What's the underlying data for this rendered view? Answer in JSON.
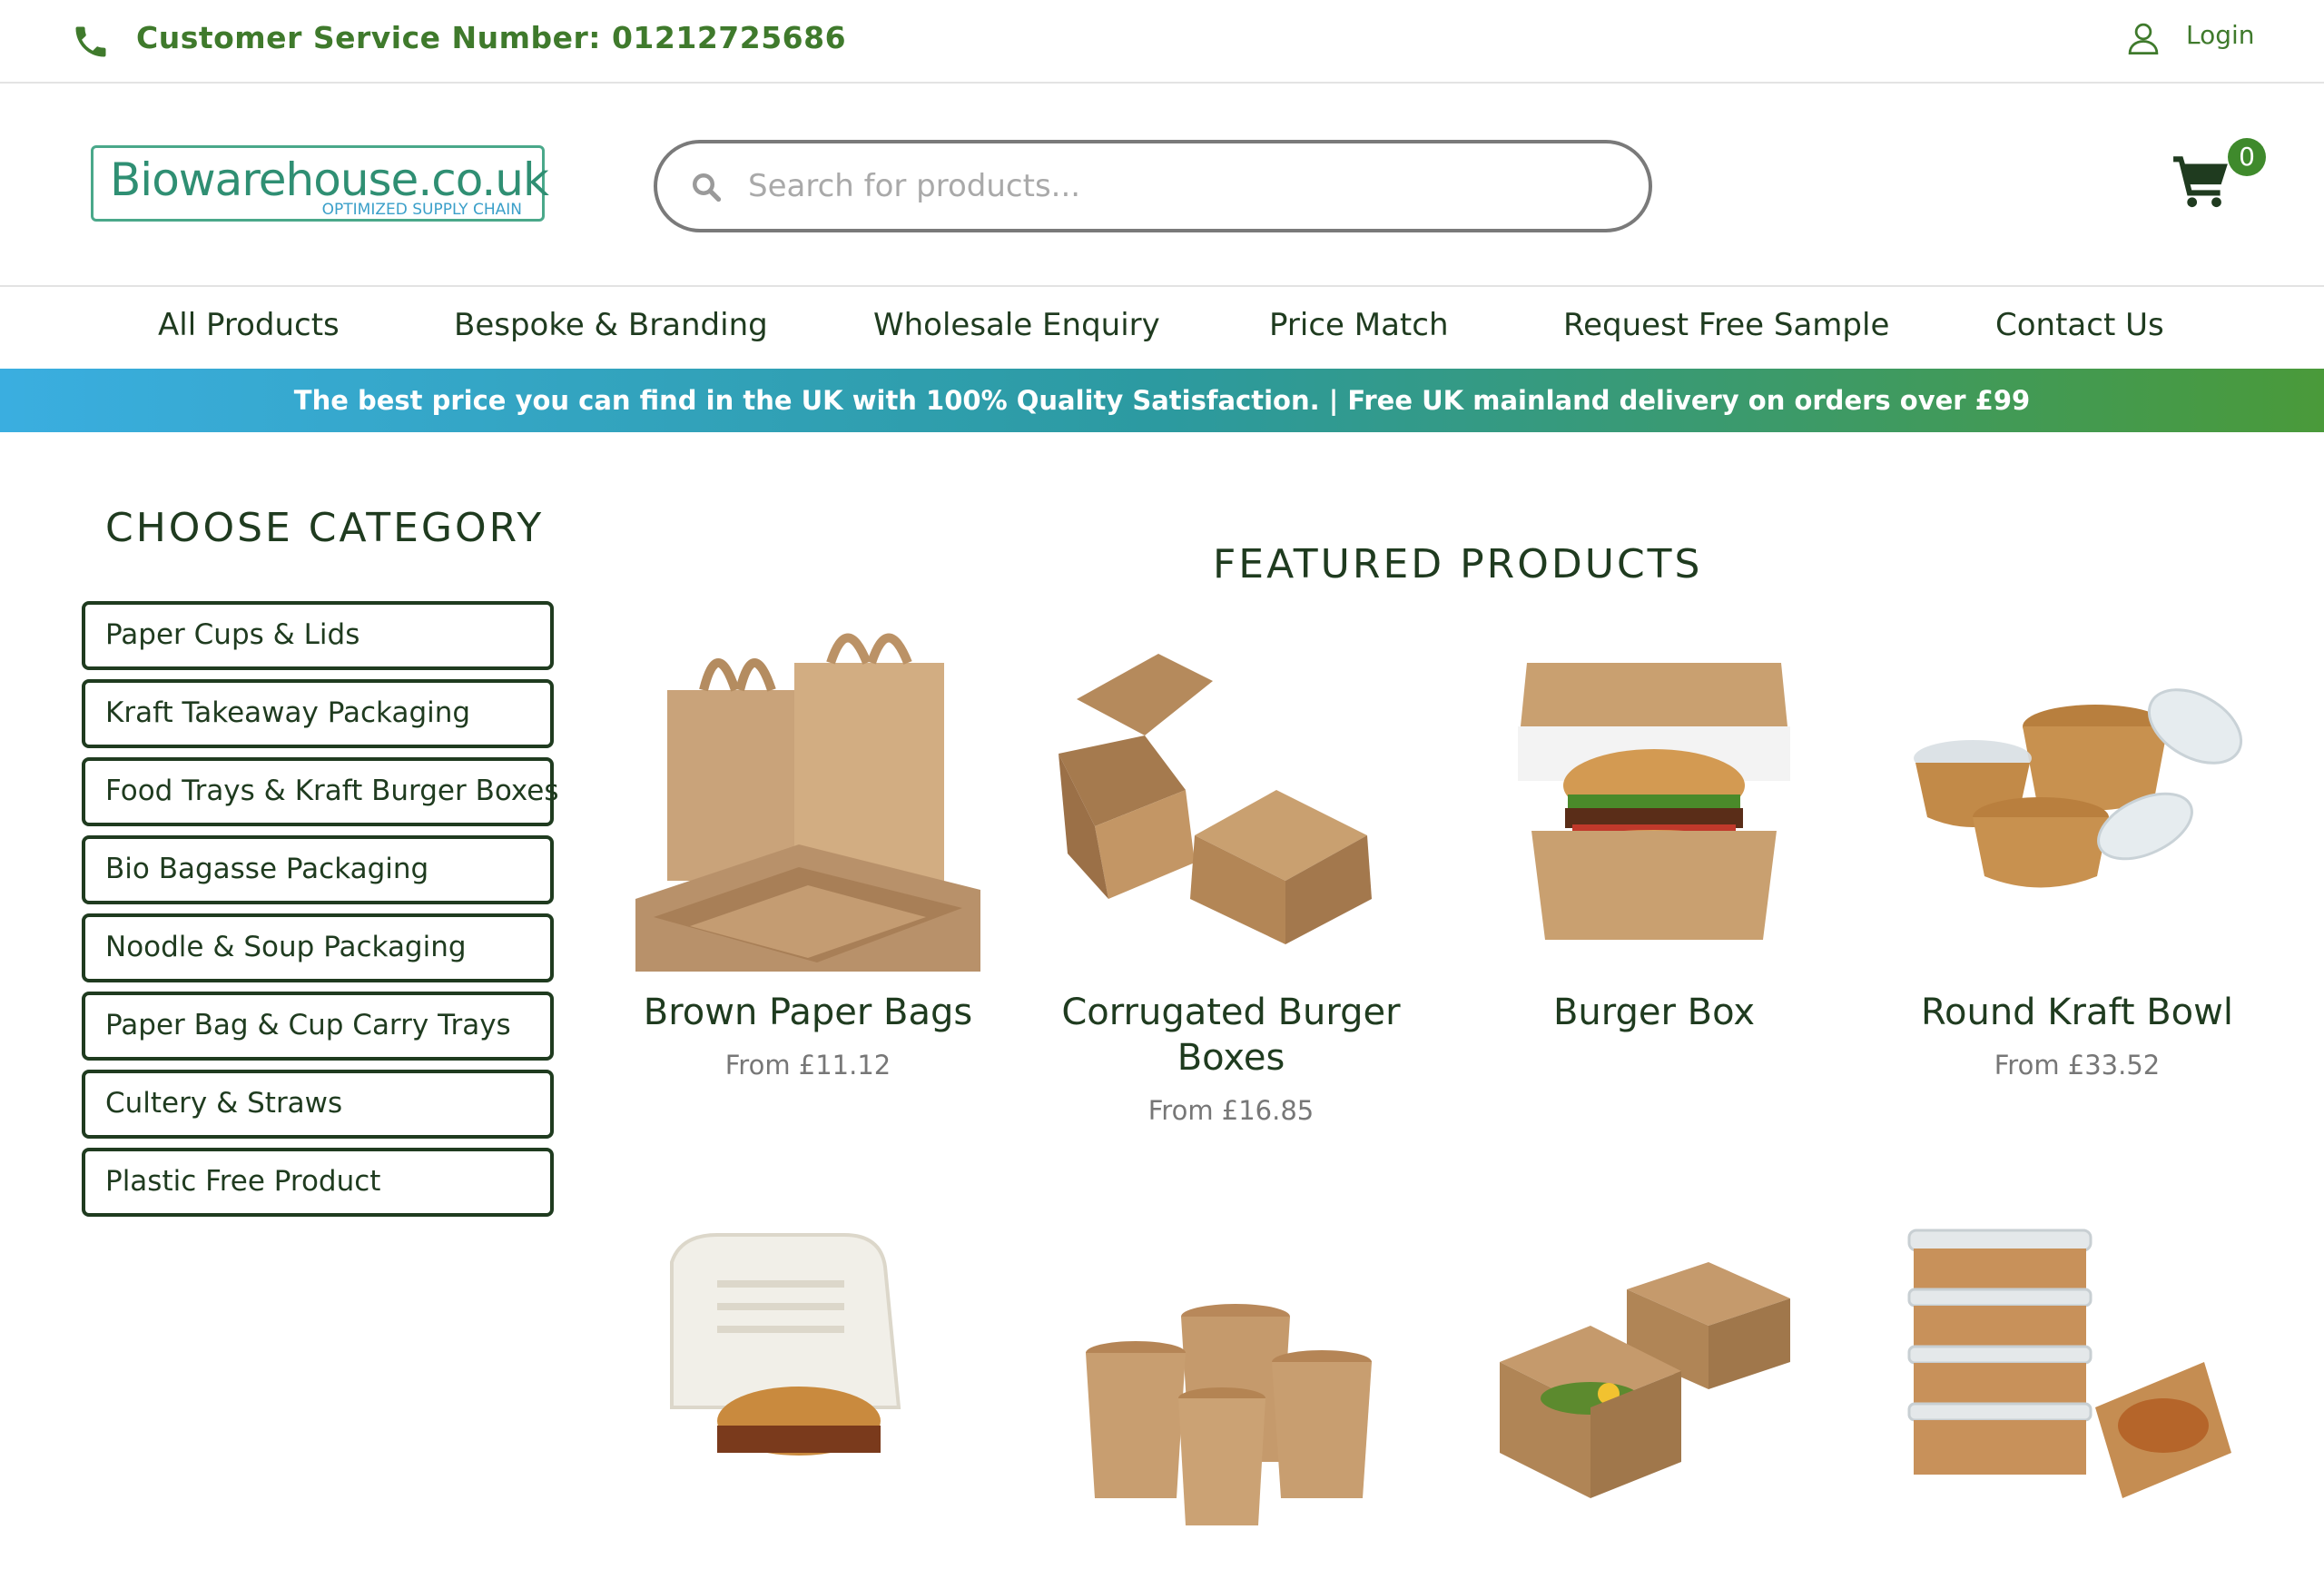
{
  "topbar": {
    "customer_service": "Customer Service Number: 01212725686",
    "login": "Login"
  },
  "header": {
    "logo_main": "Biowarehouse.co.uk",
    "logo_sub": "OPTIMIZED SUPPLY CHAIN",
    "search_placeholder": "Search for products...",
    "cart_count": "0"
  },
  "nav": {
    "items": [
      "All Products",
      "Bespoke & Branding",
      "Wholesale Enquiry",
      "Price Match",
      "Request Free Sample",
      "Contact Us"
    ]
  },
  "promo": "The best price you can find in the UK with 100% Quality Satisfaction. |  Free UK mainland delivery on orders over £99",
  "sidebar": {
    "title": "CHOOSE CATEGORY",
    "categories": [
      "Paper Cups & Lids",
      "Kraft Takeaway Packaging",
      "Food Trays & Kraft Burger Boxes",
      "Bio Bagasse Packaging",
      "Noodle & Soup Packaging",
      "Paper Bag & Cup Carry Trays",
      "Cultery & Straws",
      "Plastic Free Product"
    ]
  },
  "featured": {
    "title": "FEATURED PRODUCTS",
    "products": [
      {
        "name": "Brown Paper Bags",
        "price": "From £11.12"
      },
      {
        "name": "Corrugated Burger Boxes",
        "price": "From £16.85"
      },
      {
        "name": "Burger Box",
        "price": ""
      },
      {
        "name": "Round Kraft Bowl",
        "price": "From £33.52"
      },
      {
        "name": "",
        "price": ""
      },
      {
        "name": "",
        "price": ""
      },
      {
        "name": "",
        "price": ""
      },
      {
        "name": "",
        "price": ""
      }
    ]
  },
  "colors": {
    "brand_green": "#3f7a2c",
    "dark_green": "#1f3b1f",
    "kraft": "#c79a62",
    "promo_start": "#3aaee0",
    "promo_end": "#4a9a3a"
  }
}
